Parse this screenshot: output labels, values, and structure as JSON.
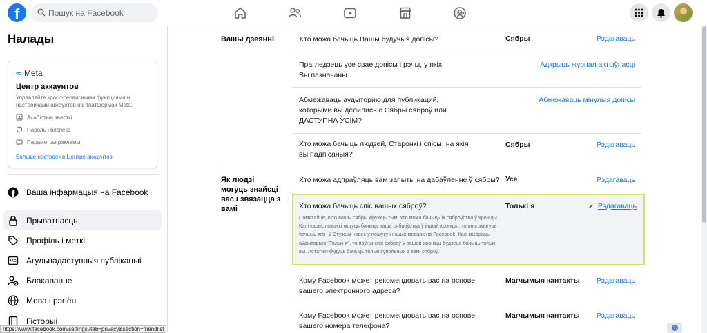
{
  "topbar": {
    "logo": "f",
    "search_placeholder": "Пошук на Facebook",
    "nav_icons": [
      "home-icon",
      "friends-icon",
      "video-icon",
      "marketplace-icon",
      "groups-icon"
    ],
    "right_icons": [
      "menu-grid-icon",
      "notifications-icon",
      "avatar"
    ]
  },
  "sidebar": {
    "title": "Налады",
    "accounts_card": {
      "brand": "Meta",
      "title": "Центр аккаунтов",
      "description": "Управляйте кросс-сервисными функциями и настройками аккаунтов на платформах Meta.",
      "items": [
        {
          "icon": "personal-info-icon",
          "label": "Асабістыя звесткі"
        },
        {
          "icon": "shield-icon",
          "label": "Пароль і бяспека"
        },
        {
          "icon": "ads-icon",
          "label": "Параметры рэкламы"
        }
      ],
      "link": "Больше настроек в Центре аккаунтов"
    },
    "items": [
      {
        "icon": "facebook-icon",
        "label": "Ваша інфармацыя на Facebook"
      },
      {
        "icon": "lock-icon",
        "label": "Прыватнасць",
        "active": true
      },
      {
        "icon": "tag-icon",
        "label": "Профіль і меткі"
      },
      {
        "icon": "public-posts-icon",
        "label": "Агульнадаступныя публікацыі"
      },
      {
        "icon": "blocking-icon",
        "label": "Блакаванне"
      },
      {
        "icon": "globe-icon",
        "label": "Мова і рэгіён"
      },
      {
        "icon": "stories-icon",
        "label": "Гісторыі"
      }
    ]
  },
  "main": {
    "section1_label": "Вашы дзеянні",
    "section2_label": "Як людзі могуць знайсці вас і звязацца з вамі",
    "rows": [
      {
        "q": "Хто можа бачыць Вашы будучыя допісы?",
        "v": "Сябры",
        "a": "Рэдагаваць"
      },
      {
        "q": "Прагледзець усе свае допісы і рэчы, у якіх Вы пазначаны",
        "v": "",
        "a": "Адкрыць журнал актыўнасці"
      },
      {
        "q": "Абмежаваць аудыторию для публикаций, которыми вы делились с Сябры сяброў или ДАСТУПНА ЎСІМ?",
        "v": "",
        "a": "Абмежаваць мінулыя допісы"
      },
      {
        "q": "Хто можа бачыць людзей, Старонкі і спісы, на якія вы падпісаныя?",
        "v": "Сябры",
        "a": "Рэдагаваць"
      },
      {
        "q": "Хто можа адпраўляць вам запыты на дабаўленне ў сябры?",
        "v": "Усе",
        "a": "Рэдагаваць"
      },
      {
        "q": "Кому Facebook может рекомендовать вас на основе вашего электронного адреса?",
        "v": "Магчымыя кантакты",
        "a": "Рэдагаваць"
      },
      {
        "q": "Кому Facebook может рекомендовать вас на основе вашего номера телефона?",
        "v": "Магчымыя кантакты",
        "a": "Рэдагаваць"
      }
    ],
    "highlight": {
      "q": "Хто можа бачыць спіс вашых сяброў?",
      "desc": "Памятайце, што вашы сябры кіруюць тым, хто можа бачыць іх сяброўства ў хроніцы. Калі карыстальнікі могуць бачыць ваша сяброўства ў іншай хроніцы, то яны змогуць бачыць яго і ў Стужцы навін, у пошуку і іншых месцах на Facebook. Калі выбраць аўдыторыю \"Толькі я\", то поўны спіс сяброў у вашай хроніцы будзеце бачыць толькі вы. Астатнія будуць бачыць толькі супольных з вамі сяброў.",
      "v": "Толькі я",
      "a": "Рэдагаваць"
    }
  },
  "statusbar": {
    "url": "https://www.facebook.com/settings?tab=privacy&section=friendlist"
  }
}
